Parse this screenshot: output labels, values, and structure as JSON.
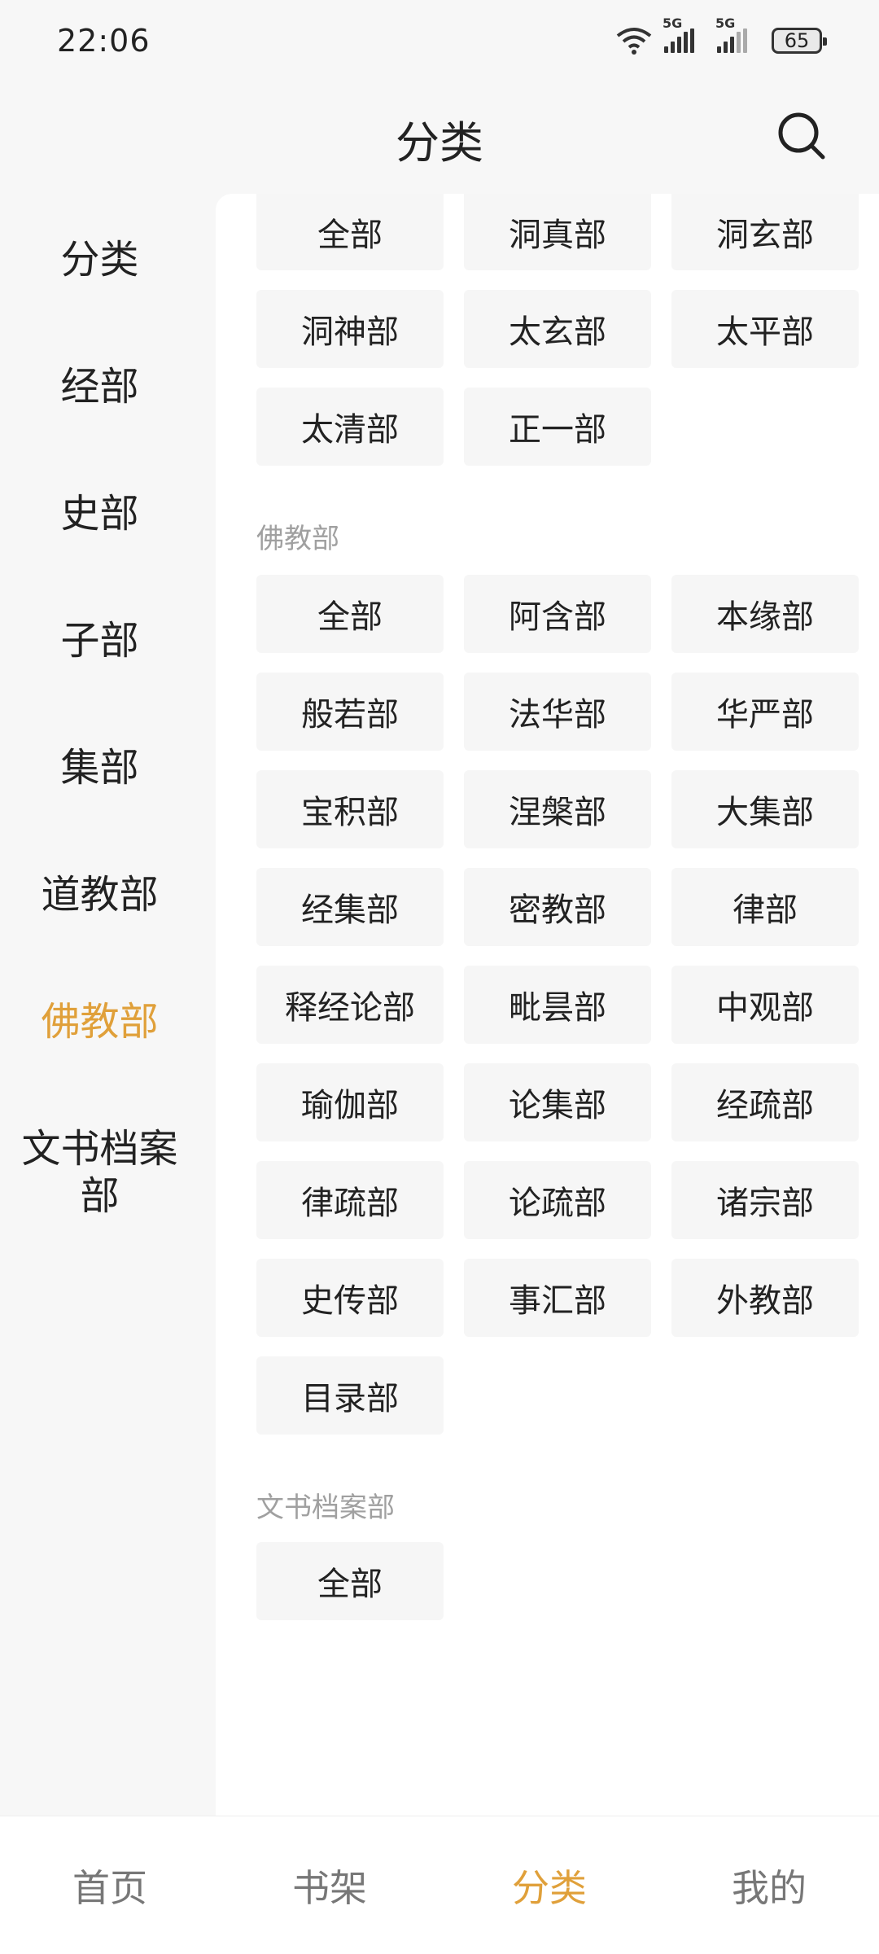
{
  "status": {
    "time": "22:06",
    "battery": "65",
    "net1": "5G",
    "net2": "5G"
  },
  "header": {
    "title": "分类"
  },
  "accent_color": "#e0a03a",
  "sidebar": {
    "items": [
      {
        "label": "分类"
      },
      {
        "label": "经部"
      },
      {
        "label": "史部"
      },
      {
        "label": "子部"
      },
      {
        "label": "集部"
      },
      {
        "label": "道教部"
      },
      {
        "label": "佛教部",
        "active": true
      },
      {
        "label": "文书档案部"
      }
    ]
  },
  "sections": {
    "daojiao": {
      "chips": [
        "全部",
        "洞真部",
        "洞玄部",
        "洞神部",
        "太玄部",
        "太平部",
        "太清部",
        "正一部"
      ]
    },
    "fojiao": {
      "label": "佛教部",
      "chips": [
        "全部",
        "阿含部",
        "本缘部",
        "般若部",
        "法华部",
        "华严部",
        "宝积部",
        "涅槃部",
        "大集部",
        "经集部",
        "密教部",
        "律部",
        "释经论部",
        "毗昙部",
        "中观部",
        "瑜伽部",
        "论集部",
        "经疏部",
        "律疏部",
        "论疏部",
        "诸宗部",
        "史传部",
        "事汇部",
        "外教部",
        "目录部"
      ]
    },
    "wenshu": {
      "label": "文书档案部",
      "chips": [
        "全部"
      ]
    }
  },
  "bottom_nav": {
    "items": [
      {
        "label": "首页"
      },
      {
        "label": "书架"
      },
      {
        "label": "分类",
        "active": true
      },
      {
        "label": "我的"
      }
    ]
  }
}
